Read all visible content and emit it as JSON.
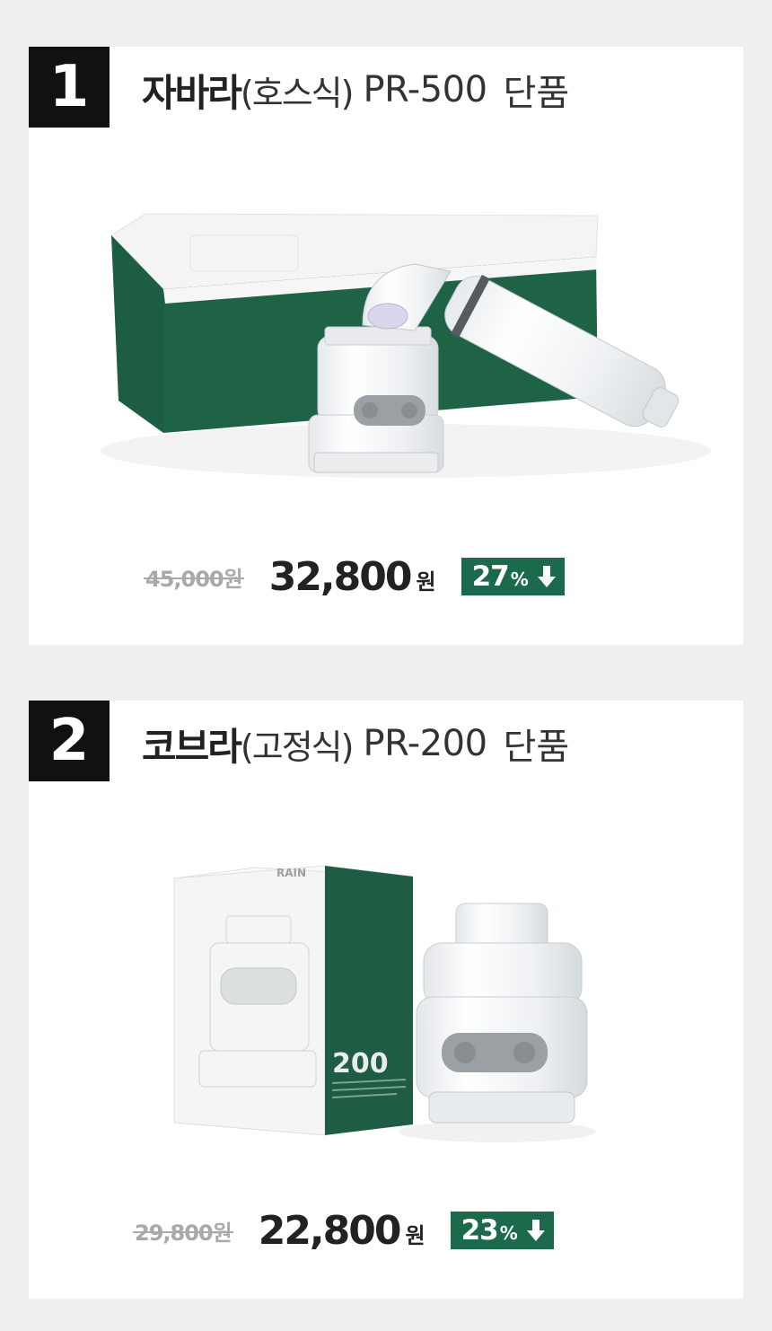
{
  "products": [
    {
      "number": "1",
      "brand": "자바라",
      "type": "(호스식)",
      "model": "PR-500",
      "suffix": "단품",
      "original_price": "45,000원",
      "sale_price": "32,800",
      "currency": "원",
      "discount_value": "27",
      "discount_unit": "%",
      "image_icon": "hose-shower-filter-with-box"
    },
    {
      "number": "2",
      "brand": "코브라",
      "type": "(고정식)",
      "model": "PR-200",
      "suffix": "단품",
      "original_price": "29,800원",
      "sale_price": "22,800",
      "currency": "원",
      "discount_value": "23",
      "discount_unit": "%",
      "image_icon": "fixed-faucet-filter-with-box",
      "box_text": "200",
      "box_logo": "RAIN"
    }
  ],
  "colors": {
    "badge_bg": "#111111",
    "discount_bg": "#1c6a4c",
    "box_green": "#1f5c44",
    "page_bg": "#efefef"
  }
}
